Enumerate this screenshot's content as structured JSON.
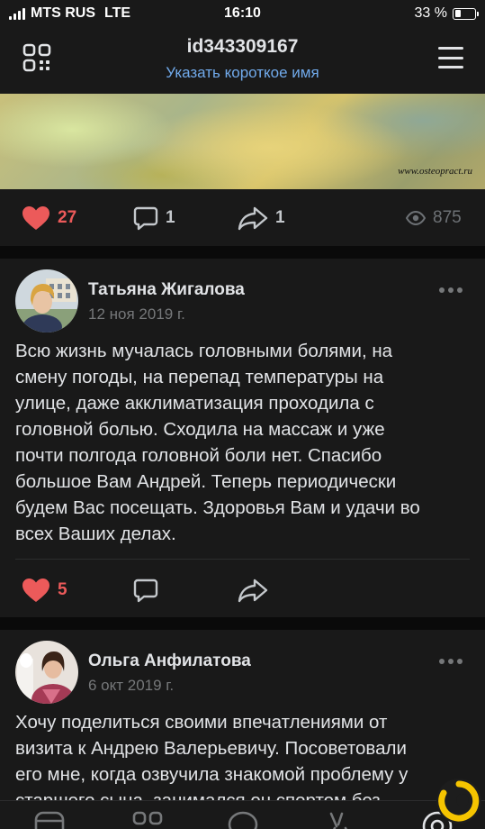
{
  "status_bar": {
    "carrier": "MTS RUS",
    "network": "LTE",
    "time": "16:10",
    "battery": "33 %"
  },
  "header": {
    "title": "id343309167",
    "subtitle": "Указать короткое имя"
  },
  "post_image": {
    "watermark": "www.osteopract.ru"
  },
  "post_stats": {
    "likes": "27",
    "comments": "1",
    "reposts": "1",
    "views": "875"
  },
  "comments": [
    {
      "author": "Татьяна Жигалова",
      "date": "12 ноя 2019 г.",
      "text_lines": [
        "Всю жизнь мучалась головными болями, на",
        "смену погоды, на перепад температуры на",
        "улице, даже акклиматизация проходила с",
        "головной болью. Сходила на массаж и уже",
        "почти полгода головной боли нет. Спасибо",
        "большое Вам Андрей. Теперь периодически",
        "будем Вас посещать. Здоровья Вам и удачи во",
        "всех Ваших делах."
      ],
      "likes": "5"
    },
    {
      "author": "Ольга Анфилатова",
      "date": "6 окт 2019 г.",
      "text_lines": [
        "Хочу поделиться своими впечатлениями от",
        "визита к Андрею Валерьевичу. Посоветовали",
        "его мне, когда озвучила знакомой проблему у",
        "старшего сына, занимался он спортом без"
      ]
    }
  ],
  "colors": {
    "background": "#0a0a0a",
    "card": "#191919",
    "accent_link": "#71aaeb",
    "like": "#ec5a5a",
    "secondary_text": "#76787a"
  },
  "icons": {
    "qr": "qr-code-icon",
    "menu": "menu-icon",
    "like": "heart-icon",
    "comment": "comment-icon",
    "share": "share-arrow-icon",
    "views": "eye-icon",
    "more": "more-dots-icon"
  }
}
